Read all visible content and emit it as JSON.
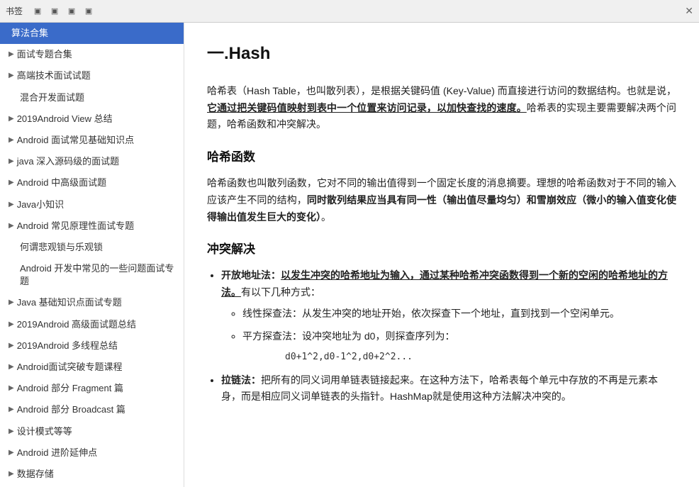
{
  "titlebar": {
    "label": "书签",
    "close_label": "✕",
    "icons": [
      "▣",
      "▣",
      "▣",
      "▣"
    ]
  },
  "sidebar": {
    "items": [
      {
        "id": "suanfa",
        "label": "算法合集",
        "indent": false,
        "active": true,
        "arrow": ""
      },
      {
        "id": "mianshi",
        "label": "面试专题合集",
        "indent": false,
        "active": false,
        "arrow": "▶"
      },
      {
        "id": "gaoji",
        "label": "高端技术面试试题",
        "indent": false,
        "active": false,
        "arrow": "▶"
      },
      {
        "id": "hunhe",
        "label": "混合开发面试题",
        "indent": true,
        "active": false,
        "arrow": ""
      },
      {
        "id": "android2019view",
        "label": "2019Android View 总结",
        "indent": false,
        "active": false,
        "arrow": "▶"
      },
      {
        "id": "androidjc",
        "label": "Android 面试常见基础知识点",
        "indent": false,
        "active": false,
        "arrow": "▶"
      },
      {
        "id": "javasrc",
        "label": "java 深入源码级的面试题",
        "indent": false,
        "active": false,
        "arrow": "▶"
      },
      {
        "id": "androidzj",
        "label": "Android 中高级面试题",
        "indent": false,
        "active": false,
        "arrow": "▶"
      },
      {
        "id": "javaknow",
        "label": "Java小知识",
        "indent": false,
        "active": false,
        "arrow": "▶"
      },
      {
        "id": "androidyl",
        "label": "Android 常见原理性面试专题",
        "indent": false,
        "active": false,
        "arrow": "▶"
      },
      {
        "id": "heguan",
        "label": "何谓悲观锁与乐观锁",
        "indent": true,
        "active": false,
        "arrow": ""
      },
      {
        "id": "androidwt",
        "label": "Android 开发中常见的一些问题面试专题",
        "indent": true,
        "active": false,
        "arrow": ""
      },
      {
        "id": "javajc",
        "label": "Java 基础知识点面试专题",
        "indent": false,
        "active": false,
        "arrow": "▶"
      },
      {
        "id": "android2019gj",
        "label": "2019Android 高级面试题总结",
        "indent": false,
        "active": false,
        "arrow": "▶"
      },
      {
        "id": "android2019mt",
        "label": "2019Android 多线程总结",
        "indent": false,
        "active": false,
        "arrow": "▶"
      },
      {
        "id": "androidtk",
        "label": "Android面试突破专题课程",
        "indent": false,
        "active": false,
        "arrow": "▶"
      },
      {
        "id": "androidfrag",
        "label": "Android 部分 Fragment 篇",
        "indent": false,
        "active": false,
        "arrow": "▶"
      },
      {
        "id": "androidbroadcast",
        "label": "Android 部分 Broadcast 篇",
        "indent": false,
        "active": false,
        "arrow": "▶"
      },
      {
        "id": "sheji",
        "label": "设计模式等等",
        "indent": false,
        "active": false,
        "arrow": "▶"
      },
      {
        "id": "androidjj",
        "label": "Android 进阶延伸点",
        "indent": false,
        "active": false,
        "arrow": "▶"
      },
      {
        "id": "shujucc",
        "label": "数据存储",
        "indent": false,
        "active": false,
        "arrow": "▶"
      }
    ]
  },
  "content": {
    "title": "一.Hash",
    "intro": "哈希表（Hash Table，也叫散列表），是根据关键码值 (Key-Value) 而直接进行访问的数据结构。也就是说，",
    "intro_bold": "它通过把关键码值映射到表中一个位置来访问记录，以加快查找的速度。",
    "intro_end": "哈希表的实现主要需要解决两个问题，哈希函数和冲突解决。",
    "hash_func_title": "哈希函数",
    "hash_func_p1": "哈希函数也叫散列函数，它对不同的输出值得到一个固定长度的消息摘要。理想的哈希函数对于不同的输入应该产生不同的结构，",
    "hash_func_p1_bold": "同时散列结果应当具有同一性（输出值尽量均匀）和雪崩效应（微小的输入值变化使得输出值发生巨大的变化）",
    "hash_func_p1_end": "。",
    "conflict_title": "冲突解决",
    "open_addr_prefix": "开放地址法：",
    "open_addr_bold": "以发生冲突的哈希地址为输入，通过某种哈希冲突函数得到一个新的空闲的哈希地址的方法。",
    "open_addr_end": "有以下几种方式：",
    "linear_probe": "线性探查法：从发生冲突的地址开始，依次探查下一个地址，直到找到一个空闲单元。",
    "square_probe": "平方探查法：设冲突地址为 d0，则探查序列为：",
    "square_formula": "d0+1^2,d0-1^2,d0+2^2...",
    "chain_prefix": "拉链法：",
    "chain_text": "把所有的同义词用单链表链接起来。在这种方法下，哈希表每个单元中存放的不再是元素本身，而是相应同义词单链表的头指针。HashMap就是使用这种方法解决冲突的。"
  }
}
